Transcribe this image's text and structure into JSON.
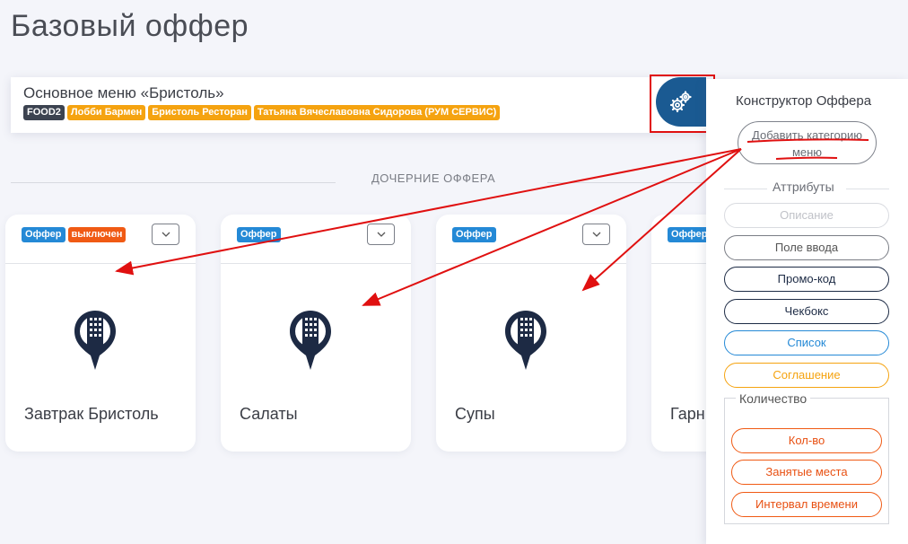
{
  "page": {
    "title": "Базовый оффер"
  },
  "main_offer": {
    "name": "Основное меню «Бристоль»",
    "tags": [
      {
        "label": "FOOD2",
        "style": "dark"
      },
      {
        "label": "Лобби Бармен",
        "style": "orange"
      },
      {
        "label": "Бристоль Ресторан",
        "style": "orange"
      },
      {
        "label": "Татьяна Вячеславовна Сидорова (РУМ СЕРВИС)",
        "style": "orange"
      }
    ],
    "settings_icon": "gears-icon"
  },
  "section": {
    "child_offers_label": "ДОЧЕРНИЕ ОФФЕРА"
  },
  "cards": [
    {
      "name": "Завтрак Бристоль",
      "badge": "Оффер",
      "status": "выключен",
      "icon": "building-pin-icon"
    },
    {
      "name": "Салаты",
      "badge": "Оффер",
      "icon": "building-pin-icon"
    },
    {
      "name": "Супы",
      "badge": "Оффер",
      "icon": "building-pin-icon"
    },
    {
      "name": "Гарн",
      "badge": "Оффер",
      "icon": "building-pin-icon"
    }
  ],
  "constructor": {
    "title": "Конструктор Оффера",
    "add_category": "Добавить категорию меню",
    "attributes_label": "Аттрибуты",
    "attributes": [
      {
        "label": "Описание",
        "color": "#c8cad0"
      },
      {
        "label": "Поле ввода",
        "color": "#7a7d85"
      },
      {
        "label": "Промо-код",
        "color": "#1d2b45"
      },
      {
        "label": "Чекбокс",
        "color": "#1d2b45"
      },
      {
        "label": "Список",
        "color": "#2489d6"
      },
      {
        "label": "Соглашение",
        "color": "#f5a310"
      }
    ],
    "quantity_label": "Количество",
    "quantity_items": [
      "Кол-во",
      "Занятые места",
      "Интервал времени"
    ]
  },
  "colors": {
    "accent_blue": "#1a5a92",
    "badge_blue": "#2489d6",
    "badge_red": "#f05a14",
    "tag_orange": "#f5a310",
    "annotation_red": "#e01010"
  }
}
